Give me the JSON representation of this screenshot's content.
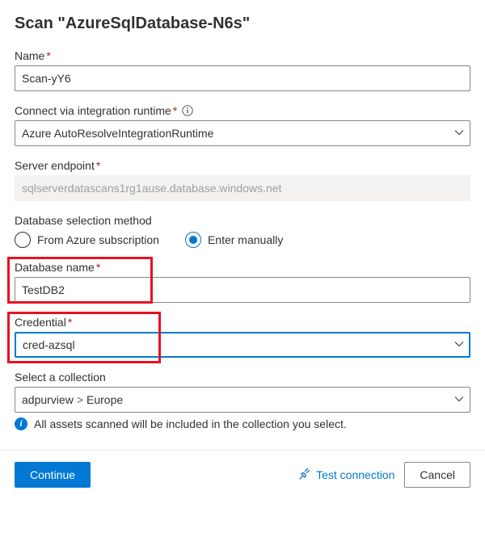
{
  "title": "Scan \"AzureSqlDatabase-N6s\"",
  "fields": {
    "name": {
      "label": "Name",
      "value": "Scan-yY6"
    },
    "runtime": {
      "label": "Connect via integration runtime",
      "value": "Azure AutoResolveIntegrationRuntime"
    },
    "endpoint": {
      "label": "Server endpoint",
      "value": "sqlserverdatascans1rg1ause.database.windows.net"
    },
    "dbmethod": {
      "label": "Database selection method",
      "options": {
        "subscription": "From Azure subscription",
        "manual": "Enter manually"
      },
      "selected": "manual"
    },
    "dbname": {
      "label": "Database name",
      "value": "TestDB2"
    },
    "credential": {
      "label": "Credential",
      "value": "cred-azsql"
    },
    "collection": {
      "label": "Select a collection",
      "value_parent": "adpurview",
      "value_child": "Europe",
      "info": "All assets scanned will be included in the collection you select."
    }
  },
  "footer": {
    "continue": "Continue",
    "test": "Test connection",
    "cancel": "Cancel"
  }
}
